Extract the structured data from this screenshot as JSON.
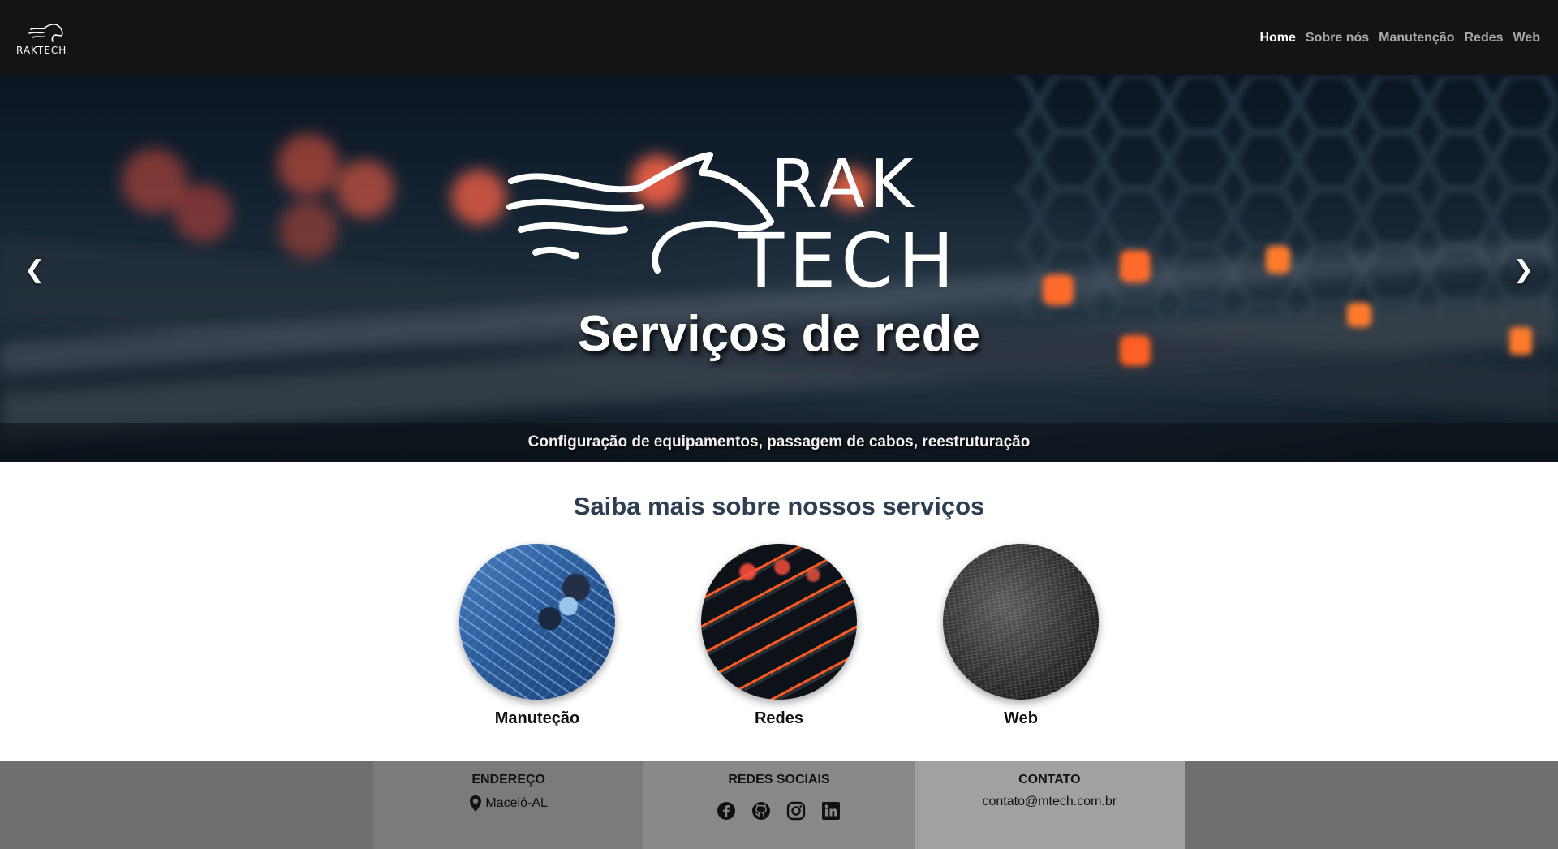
{
  "brand": {
    "logo_alt": "RAKTECH"
  },
  "nav": {
    "items": [
      {
        "label": "Home",
        "active": true
      },
      {
        "label": "Sobre nós"
      },
      {
        "label": "Manutenção"
      },
      {
        "label": "Redes"
      },
      {
        "label": "Web"
      }
    ]
  },
  "hero": {
    "logo_text_top": "RAK",
    "logo_text_bottom": "TECH",
    "title": "Serviços de rede",
    "caption": "Configuração de equipamentos, passagem de cabos, reestruturação",
    "prev_arrow": "❮",
    "next_arrow": "❯"
  },
  "services": {
    "heading": "Saiba mais sobre nossos serviços",
    "items": [
      {
        "label": "Manuteção",
        "image": "circuit-board"
      },
      {
        "label": "Redes",
        "image": "network-cables"
      },
      {
        "label": "Web",
        "image": "code-screen"
      }
    ]
  },
  "footer": {
    "address": {
      "heading": "ENDEREÇO",
      "text": "Maceió-AL",
      "icon": "map-pin-icon"
    },
    "social": {
      "heading": "REDES SOCIAIS",
      "icons": [
        "facebook-icon",
        "github-icon",
        "instagram-icon",
        "linkedin-icon"
      ]
    },
    "contact": {
      "heading": "CONTATO",
      "email": "contato@mtech.com.br"
    }
  },
  "colors": {
    "navbar": "#141414",
    "heading": "#2c3e50",
    "footer": "#6f6f6f",
    "accent_glow": "#ff5a3c"
  }
}
